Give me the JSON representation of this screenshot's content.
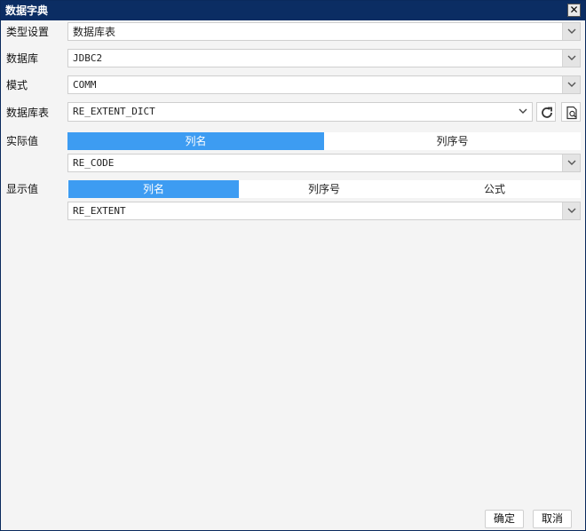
{
  "window": {
    "title": "数据字典",
    "close_glyph": "✕"
  },
  "fields": {
    "type_setting": {
      "label": "类型设置",
      "value": "数据库表"
    },
    "database": {
      "label": "数据库",
      "value": "JDBC2"
    },
    "schema": {
      "label": "模式",
      "value": "COMM"
    },
    "table": {
      "label": "数据库表",
      "value": "RE_EXTENT_DICT"
    }
  },
  "actual_value": {
    "label": "实际值",
    "tabs": [
      "列名",
      "列序号"
    ],
    "active_tab": 0,
    "value": "RE_CODE"
  },
  "display_value": {
    "label": "显示值",
    "tabs": [
      "列名",
      "列序号",
      "公式"
    ],
    "active_tab": 0,
    "value": "RE_EXTENT"
  },
  "buttons": {
    "ok": "确定",
    "cancel": "取消"
  },
  "icons": [
    "close-icon",
    "chevron-down-icon",
    "refresh-icon",
    "preview-icon"
  ],
  "colors": {
    "titlebar": "#0b2d63",
    "active_tab": "#3d9cf2"
  }
}
